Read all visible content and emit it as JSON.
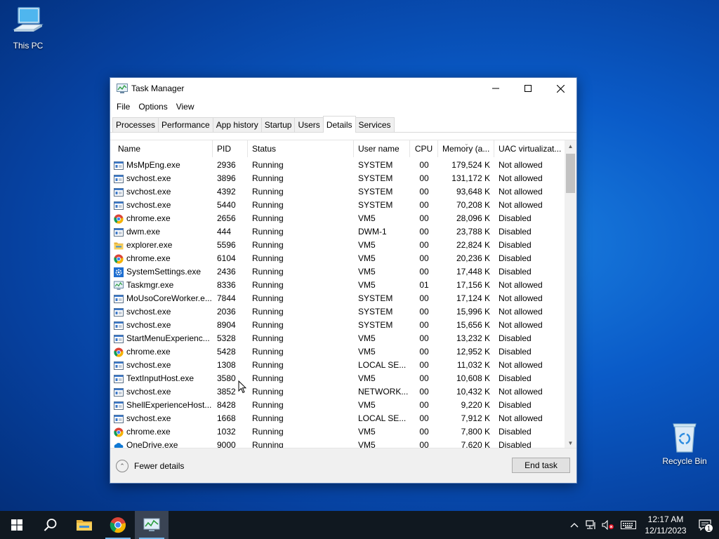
{
  "desktop": {
    "icons": [
      {
        "label": "This PC"
      },
      {
        "label": "Recycle Bin"
      }
    ]
  },
  "window": {
    "title": "Task Manager",
    "menu": [
      "File",
      "Options",
      "View"
    ],
    "tabs": [
      {
        "label": "Processes",
        "active": false
      },
      {
        "label": "Performance",
        "active": false
      },
      {
        "label": "App history",
        "active": false
      },
      {
        "label": "Startup",
        "active": false
      },
      {
        "label": "Users",
        "active": false
      },
      {
        "label": "Details",
        "active": true
      },
      {
        "label": "Services",
        "active": false
      }
    ],
    "columns": [
      "Name",
      "PID",
      "Status",
      "User name",
      "CPU",
      "Memory (a...",
      "UAC virtualizat..."
    ],
    "rows": [
      {
        "icon": "generic",
        "name": "MsMpEng.exe",
        "pid": "2936",
        "status": "Running",
        "user": "SYSTEM",
        "cpu": "00",
        "mem": "179,524 K",
        "uac": "Not allowed"
      },
      {
        "icon": "generic",
        "name": "svchost.exe",
        "pid": "3896",
        "status": "Running",
        "user": "SYSTEM",
        "cpu": "00",
        "mem": "131,172 K",
        "uac": "Not allowed"
      },
      {
        "icon": "generic",
        "name": "svchost.exe",
        "pid": "4392",
        "status": "Running",
        "user": "SYSTEM",
        "cpu": "00",
        "mem": "93,648 K",
        "uac": "Not allowed"
      },
      {
        "icon": "generic",
        "name": "svchost.exe",
        "pid": "5440",
        "status": "Running",
        "user": "SYSTEM",
        "cpu": "00",
        "mem": "70,208 K",
        "uac": "Not allowed"
      },
      {
        "icon": "chrome",
        "name": "chrome.exe",
        "pid": "2656",
        "status": "Running",
        "user": "VM5",
        "cpu": "00",
        "mem": "28,096 K",
        "uac": "Disabled"
      },
      {
        "icon": "generic",
        "name": "dwm.exe",
        "pid": "444",
        "status": "Running",
        "user": "DWM-1",
        "cpu": "00",
        "mem": "23,788 K",
        "uac": "Disabled"
      },
      {
        "icon": "folder",
        "name": "explorer.exe",
        "pid": "5596",
        "status": "Running",
        "user": "VM5",
        "cpu": "00",
        "mem": "22,824 K",
        "uac": "Disabled"
      },
      {
        "icon": "chrome",
        "name": "chrome.exe",
        "pid": "6104",
        "status": "Running",
        "user": "VM5",
        "cpu": "00",
        "mem": "20,236 K",
        "uac": "Disabled"
      },
      {
        "icon": "gear",
        "name": "SystemSettings.exe",
        "pid": "2436",
        "status": "Running",
        "user": "VM5",
        "cpu": "00",
        "mem": "17,448 K",
        "uac": "Disabled"
      },
      {
        "icon": "taskmgr",
        "name": "Taskmgr.exe",
        "pid": "8336",
        "status": "Running",
        "user": "VM5",
        "cpu": "01",
        "mem": "17,156 K",
        "uac": "Not allowed"
      },
      {
        "icon": "generic",
        "name": "MoUsoCoreWorker.e...",
        "pid": "7844",
        "status": "Running",
        "user": "SYSTEM",
        "cpu": "00",
        "mem": "17,124 K",
        "uac": "Not allowed"
      },
      {
        "icon": "generic",
        "name": "svchost.exe",
        "pid": "2036",
        "status": "Running",
        "user": "SYSTEM",
        "cpu": "00",
        "mem": "15,996 K",
        "uac": "Not allowed"
      },
      {
        "icon": "generic",
        "name": "svchost.exe",
        "pid": "8904",
        "status": "Running",
        "user": "SYSTEM",
        "cpu": "00",
        "mem": "15,656 K",
        "uac": "Not allowed"
      },
      {
        "icon": "generic",
        "name": "StartMenuExperienc...",
        "pid": "5328",
        "status": "Running",
        "user": "VM5",
        "cpu": "00",
        "mem": "13,232 K",
        "uac": "Disabled"
      },
      {
        "icon": "chrome",
        "name": "chrome.exe",
        "pid": "5428",
        "status": "Running",
        "user": "VM5",
        "cpu": "00",
        "mem": "12,952 K",
        "uac": "Disabled"
      },
      {
        "icon": "generic",
        "name": "svchost.exe",
        "pid": "1308",
        "status": "Running",
        "user": "LOCAL SE...",
        "cpu": "00",
        "mem": "11,032 K",
        "uac": "Not allowed"
      },
      {
        "icon": "generic",
        "name": "TextInputHost.exe",
        "pid": "3580",
        "status": "Running",
        "user": "VM5",
        "cpu": "00",
        "mem": "10,608 K",
        "uac": "Disabled"
      },
      {
        "icon": "generic",
        "name": "svchost.exe",
        "pid": "3852",
        "status": "Running",
        "user": "NETWORK...",
        "cpu": "00",
        "mem": "10,432 K",
        "uac": "Not allowed"
      },
      {
        "icon": "generic",
        "name": "ShellExperienceHost...",
        "pid": "8428",
        "status": "Running",
        "user": "VM5",
        "cpu": "00",
        "mem": "9,220 K",
        "uac": "Disabled"
      },
      {
        "icon": "generic",
        "name": "svchost.exe",
        "pid": "1668",
        "status": "Running",
        "user": "LOCAL SE...",
        "cpu": "00",
        "mem": "7,912 K",
        "uac": "Not allowed"
      },
      {
        "icon": "chrome",
        "name": "chrome.exe",
        "pid": "1032",
        "status": "Running",
        "user": "VM5",
        "cpu": "00",
        "mem": "7,800 K",
        "uac": "Disabled"
      },
      {
        "icon": "onedrive",
        "name": "OneDrive.exe",
        "pid": "9000",
        "status": "Running",
        "user": "VM5",
        "cpu": "00",
        "mem": "7,620 K",
        "uac": "Disabled"
      }
    ],
    "footer": {
      "fewer_details": "Fewer details",
      "end_task": "End task"
    }
  },
  "taskbar": {
    "pinned": [
      "windows-start-icon",
      "search-icon",
      "file-explorer-icon",
      "chrome-icon",
      "task-manager-icon"
    ],
    "clock": {
      "time": "12:17 AM",
      "date": "12/11/2023"
    },
    "notification_count": "1"
  },
  "colors": {
    "accent": "#0078d7",
    "taskbar": "#101820",
    "chrome_red": "#db4437",
    "chrome_green": "#0f9d58",
    "chrome_yellow": "#f4b400",
    "chrome_blue": "#4285f4"
  }
}
